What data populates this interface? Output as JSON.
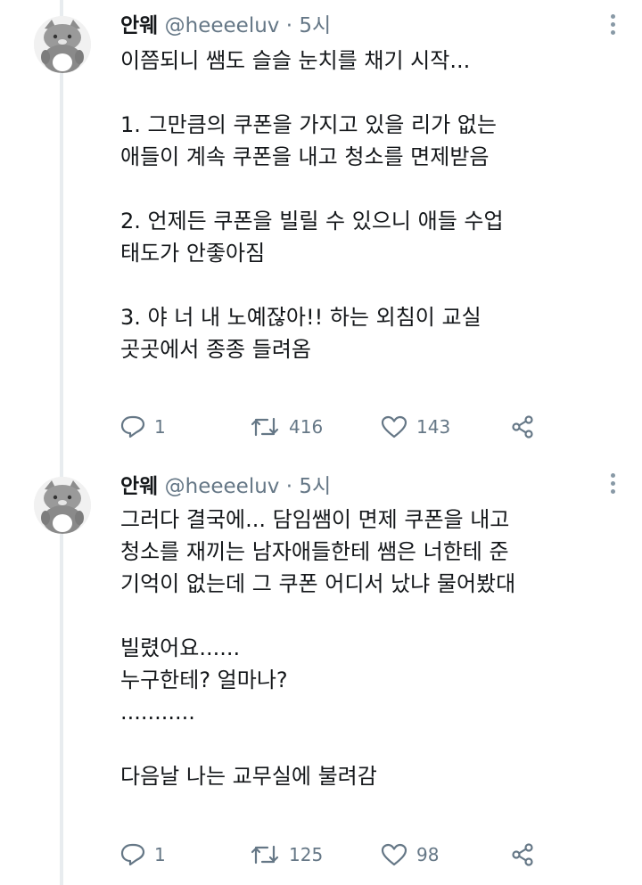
{
  "tweets": [
    {
      "name": "안웨",
      "handle": "@heeeeluv",
      "dot": "·",
      "time": "5시",
      "body": "이쯤되니 쌤도 슬슬 눈치를 채기 시작...\n\n1. 그만큼의 쿠폰을 가지고 있을 리가 없는\n애들이 계속 쿠폰을 내고 청소를 면제받음\n\n2. 언제든 쿠폰을 빌릴 수 있으니 애들 수업\n태도가 안좋아짐\n\n3. 야 너 내 노예잖아!! 하는 외침이 교실\n곳곳에서 종종 들려옴",
      "replies": "1",
      "retweets": "416",
      "likes": "143"
    },
    {
      "name": "안웨",
      "handle": "@heeeeluv",
      "dot": "·",
      "time": "5시",
      "body": "그러다 결국에... 담임쌤이 면제 쿠폰을 내고\n청소를 재끼는 남자애들한테 쌤은 너한테 준\n기억이 없는데 그 쿠폰 어디서 났냐 물어봤대\n\n빌렸어요......\n누구한테? 얼마나?\n...........\n\n다음날 나는 교무실에 불려감",
      "replies": "1",
      "retweets": "125",
      "likes": "98"
    }
  ],
  "icons": {
    "reply": "reply-icon",
    "retweet": "retweet-icon",
    "like": "heart-icon",
    "share": "share-icon",
    "more": "more-icon",
    "avatar": "cat-plush-avatar"
  },
  "colors": {
    "text": "#14171a",
    "secondary": "#657786",
    "thread_line": "#e8ecef"
  }
}
